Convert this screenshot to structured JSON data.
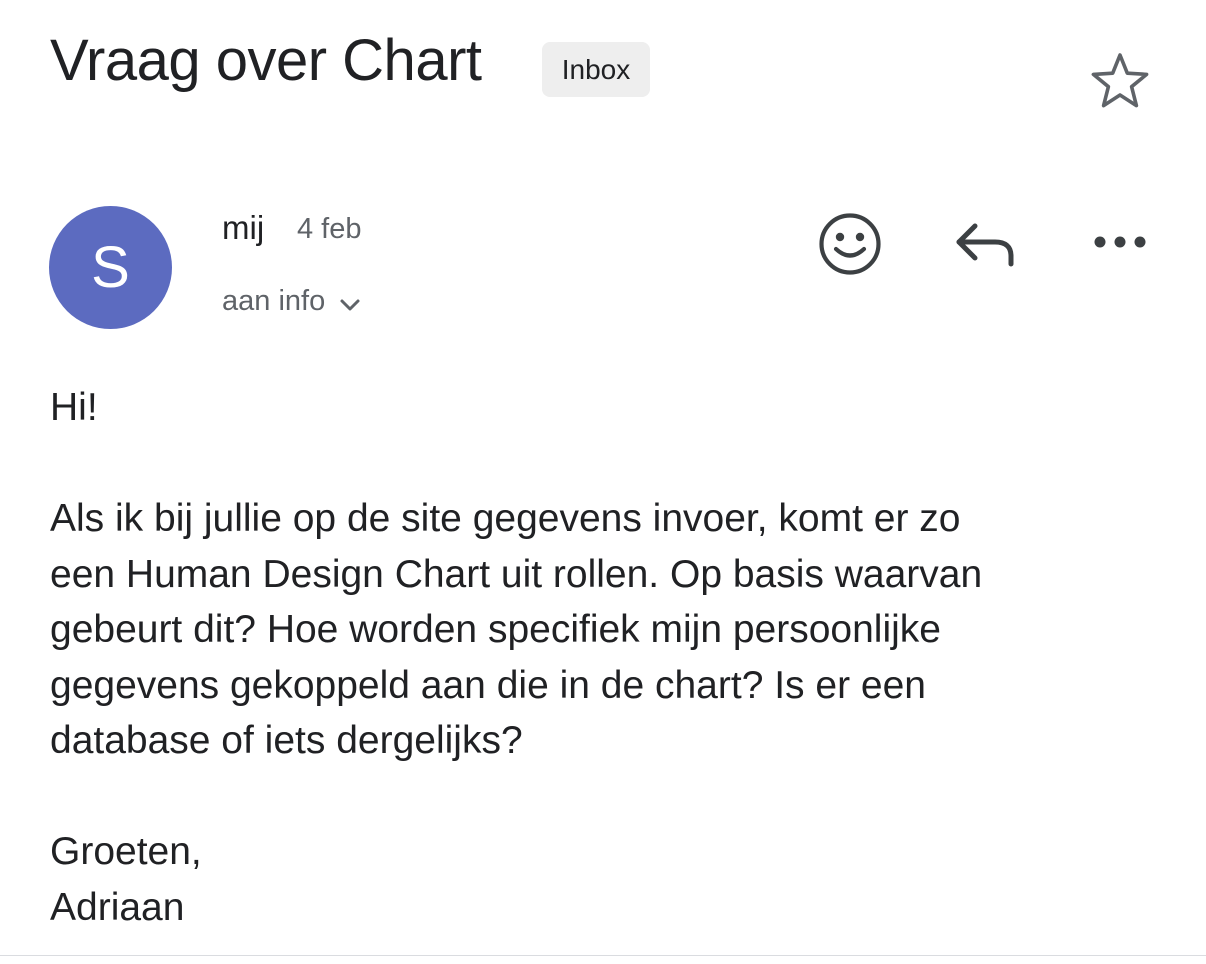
{
  "header": {
    "subject": "Vraag over Chart",
    "label_chip": "Inbox",
    "star_icon": "star-outline-icon"
  },
  "sender": {
    "avatar_letter": "S",
    "avatar_color": "#5c6bc0",
    "name": "mij",
    "date": "4 feb",
    "recipient_line": "aan info",
    "recipient_toggle_icon": "chevron-down-icon"
  },
  "actions": {
    "emoji_icon": "emoji-reaction-icon",
    "reply_icon": "reply-icon",
    "more_icon": "more-horizontal-icon"
  },
  "message": {
    "greeting": "Hi!",
    "paragraph": "Als ik bij jullie op de site gegevens invoer, komt er zo\neen Human Design Chart uit rollen. Op basis waarvan\ngebeurt dit? Hoe worden specifiek mijn persoonlijke\ngegevens gekoppeld aan die in de chart? Is er een\ndatabase of iets dergelijks?",
    "closing": "Groeten,",
    "signature": "Adriaan"
  }
}
